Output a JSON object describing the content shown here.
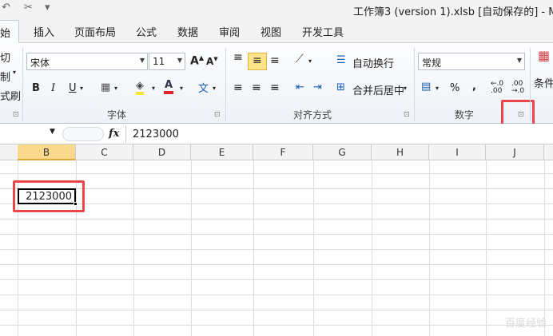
{
  "title_bar": {
    "quick_access": [
      "↶",
      "✂",
      "▾"
    ],
    "title": "工作簿3 (version 1).xlsb [自动保存的] - Micr"
  },
  "tabs": [
    {
      "label": "始"
    },
    {
      "label": "插入"
    },
    {
      "label": "页面布局"
    },
    {
      "label": "公式"
    },
    {
      "label": "数据"
    },
    {
      "label": "审阅"
    },
    {
      "label": "视图"
    },
    {
      "label": "开发工具"
    }
  ],
  "clipboard": {
    "cut": "切",
    "copy": "制",
    "format_painter": "式刷"
  },
  "font_group": {
    "label": "字体",
    "font_name": "宋体",
    "font_size": "11",
    "bold": "B",
    "italic": "I",
    "underline": "U",
    "wen": "文"
  },
  "alignment_group": {
    "label": "对齐方式",
    "wrap_text": "自动换行",
    "merge_center": "合并后居中"
  },
  "number_group": {
    "label": "数字",
    "format": "常规",
    "percent": "%",
    "comma": ",",
    "inc_decimal": "←.0 .00",
    "dec_decimal": ".00 →.0"
  },
  "styles_group": {
    "conditional": "条件"
  },
  "formula_bar": {
    "fx": "fx",
    "content": "2123000"
  },
  "columns": [
    "B",
    "C",
    "D",
    "E",
    "F",
    "G",
    "H",
    "I",
    "J"
  ],
  "active_cell": {
    "value": "2123000"
  },
  "watermark": "百度经验",
  "colors": {
    "accent_red": "#e8464b",
    "selected_column": "#f9d98b"
  }
}
